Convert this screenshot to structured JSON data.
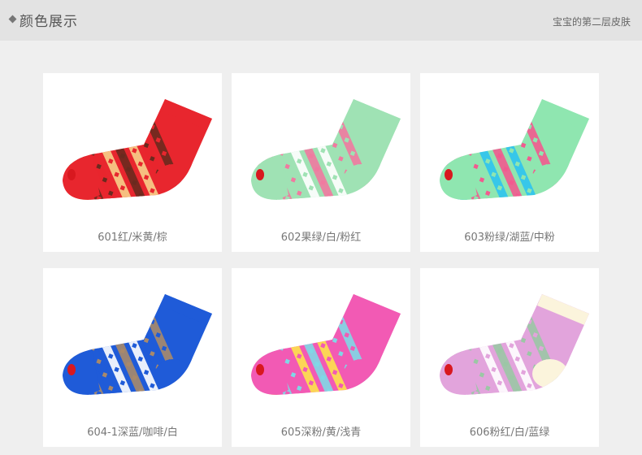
{
  "header": {
    "title": "颜色展示",
    "subtitle": "宝宝的第二层皮肤"
  },
  "products": [
    {
      "caption": "601红/米黄/棕",
      "colors": {
        "main": "#e8262e",
        "accent": "#f7d08a",
        "dark": "#6a2a1e",
        "cuff": "#e8262e",
        "heel": "#e8262e"
      }
    },
    {
      "caption": "602果绿/白/粉红",
      "colors": {
        "main": "#9fe2b4",
        "accent": "#ffffff",
        "dark": "#f07aa0",
        "cuff": "#9fe2b4",
        "heel": "#9fe2b4"
      }
    },
    {
      "caption": "603粉绿/湖蓝/中粉",
      "colors": {
        "main": "#8fe6b0",
        "accent": "#2ec3f0",
        "dark": "#f25a8f",
        "cuff": "#8fe6b0",
        "heel": "#8fe6b0"
      }
    },
    {
      "caption": "604-1深蓝/咖啡/白",
      "colors": {
        "main": "#1f5bd8",
        "accent": "#ffffff",
        "dark": "#a9896a",
        "cuff": "#1f5bd8",
        "heel": "#1f5bd8"
      }
    },
    {
      "caption": "605深粉/黄/浅青",
      "colors": {
        "main": "#f25ab4",
        "accent": "#fde24b",
        "dark": "#7fd8e6",
        "cuff": "#f25ab4",
        "heel": "#f25ab4"
      }
    },
    {
      "caption": "606粉红/白/蓝绿",
      "colors": {
        "main": "#e2a4dc",
        "accent": "#ffffff",
        "dark": "#9bc7a5",
        "cuff": "#fbf4dc",
        "heel": "#fbf4dc"
      }
    }
  ]
}
